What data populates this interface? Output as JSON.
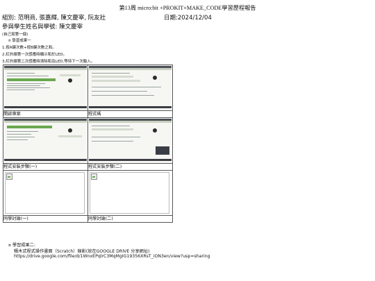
{
  "header": {
    "title": "第13周 micro:bit +PROKIT+MAKE_CODE學習歷程報告",
    "group": "組別: 范明商, 張嘉輝, 陳文慶宰, 阮友壯",
    "date": "日期:2024/12/04",
    "members": "參與學生姓名與學號: 陳文慶宰",
    "self_note": "(自己寫第一個)"
  },
  "result1": {
    "heading": "¤ 學習成果一",
    "steps": [
      "1.按A鍵次數+按B鍵次數之和。",
      "2.紅外線第一次感應時顯示和於LED。",
      "3.紅外線第二次感應時清除和及LED,等待下一次輸入。"
    ]
  },
  "grid": {
    "captions": [
      "開啟專案",
      "程式碼",
      "程式安裝步驟(一)",
      "程式安裝步驟(二)",
      "同學討論(一)",
      "同學討論(二)"
    ]
  },
  "result2": {
    "heading": "¤ 學習成果二:",
    "video_note": "積木式程式操作畫面（Scratch）錄影(放在GOOGLE DRIVE 分享網址)",
    "video_link": "https://drive.google.com/file/d/1WnxEPqlrC3MqMgIG19356XRsT_iON3en/view?usp=sharing"
  }
}
